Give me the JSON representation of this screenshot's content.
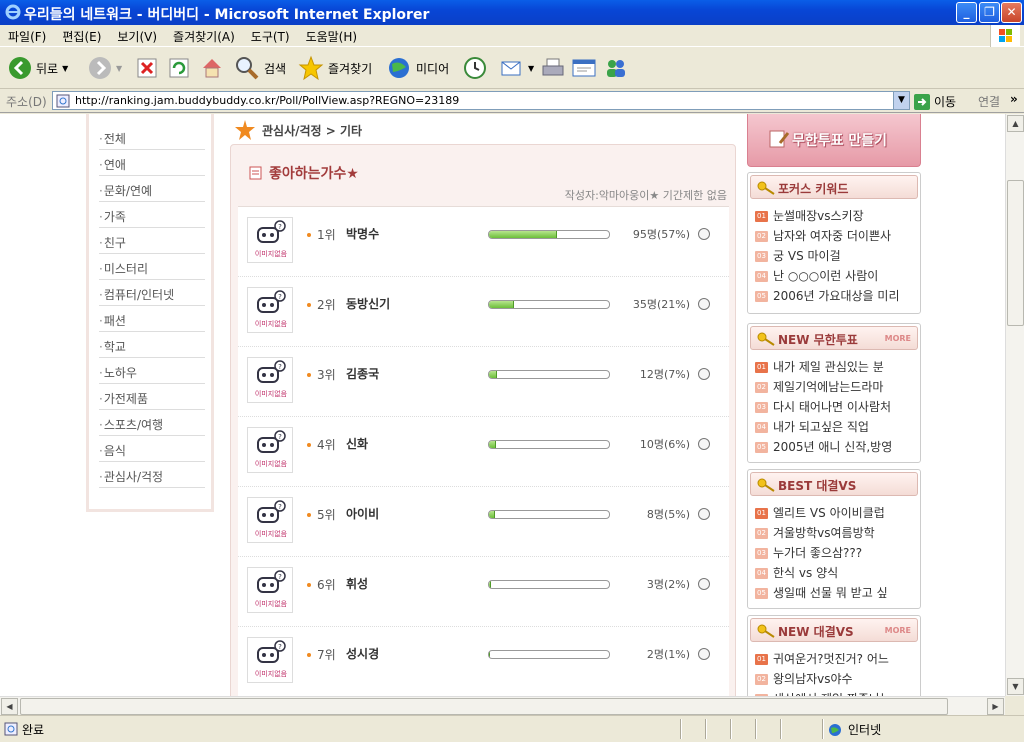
{
  "window": {
    "title": "우리들의 네트워크 - 버디버디 - Microsoft Internet Explorer"
  },
  "menu": [
    "파일(F)",
    "편집(E)",
    "보기(V)",
    "즐겨찾기(A)",
    "도구(T)",
    "도움말(H)"
  ],
  "toolbar": {
    "back": "뒤로",
    "search": "검색",
    "favorites": "즐겨찾기",
    "media": "미디어"
  },
  "address": {
    "label": "주소(D)",
    "url": "http://ranking.jam.buddybuddy.co.kr/Poll/PollView.asp?REGNO=23189",
    "go": "이동",
    "links": "연결"
  },
  "status": {
    "text": "완료",
    "zone": "인터넷"
  },
  "left_nav": [
    "전체",
    "연애",
    "문화/연예",
    "가족",
    "친구",
    "미스터리",
    "컴퓨터/인터넷",
    "패션",
    "학교",
    "노하우",
    "가전제품",
    "스포츠/여행",
    "음식",
    "관심사/걱정"
  ],
  "breadcrumb": "관심사/걱정 > 기타",
  "poll": {
    "title": "좋아하는가수★",
    "meta": "작성자:악마아웅이★  기간제한 없음",
    "image_alt": "이미지없음",
    "items": [
      {
        "rank": "1위",
        "name": "박명수",
        "count": "95명(57%)",
        "pct": 57
      },
      {
        "rank": "2위",
        "name": "동방신기",
        "count": "35명(21%)",
        "pct": 21
      },
      {
        "rank": "3위",
        "name": "김종국",
        "count": "12명(7%)",
        "pct": 7
      },
      {
        "rank": "4위",
        "name": "신화",
        "count": "10명(6%)",
        "pct": 6
      },
      {
        "rank": "5위",
        "name": "아이비",
        "count": "8명(5%)",
        "pct": 5
      },
      {
        "rank": "6위",
        "name": "휘성",
        "count": "3명(2%)",
        "pct": 2
      },
      {
        "rank": "7위",
        "name": "성시경",
        "count": "2명(1%)",
        "pct": 1
      }
    ]
  },
  "right": {
    "make_button": "무한투표 만들기",
    "more": "MORE",
    "panels": [
      {
        "title": "포커스 키워드",
        "more": false,
        "items": [
          "눈썰매장vs스키장",
          "남자와 여자중 더이쁜사",
          "궁 VS 마이걸",
          "난 ○○○이런 사람이",
          "2006년 가요대상을 미리"
        ]
      },
      {
        "title": "NEW 무한투표",
        "more": true,
        "items": [
          "내가 제일 관심있는 분",
          "제일기억에남는드라마",
          "다시 태어나면 이사람처",
          "내가 되고싶은 직업",
          "2005년 애니 신작,방영"
        ]
      },
      {
        "title": "BEST 대결VS",
        "more": false,
        "items": [
          "엘리트 VS 아이비클럽",
          "겨울방학vs여름방학",
          "누가더 좋으삼???",
          "한식 vs 양식",
          "생일때 선물 뭐 받고 싶"
        ]
      },
      {
        "title": "NEW 대결VS",
        "more": true,
        "items": [
          "귀여운거?멋진거? 어느",
          "왕의남자vs야수",
          "세상에서 제일 짜증나는"
        ]
      }
    ],
    "item_numbers": [
      "01",
      "02",
      "03",
      "04",
      "05"
    ]
  }
}
